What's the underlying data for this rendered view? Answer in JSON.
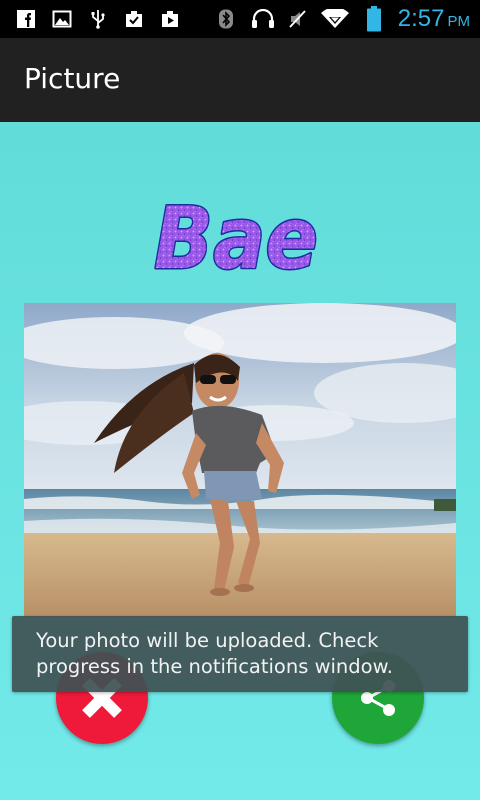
{
  "status_bar": {
    "time": "2:57",
    "ampm": "PM",
    "icons": [
      "facebook-icon",
      "gallery-icon",
      "usb-icon",
      "clipboard-check-icon",
      "media-icon",
      "bluetooth-icon",
      "headset-icon",
      "mute-icon",
      "wifi-icon",
      "battery-icon"
    ],
    "time_color": "#33b5e5"
  },
  "action_bar": {
    "title": "Picture"
  },
  "content": {
    "logo_text": "Bae",
    "photo_subject": "Woman in sunglasses running on a beach",
    "toast": "Your photo will be uploaded. Check progress in the notifications window."
  },
  "actions": {
    "cancel_icon": "close-icon",
    "share_icon": "share-icon"
  },
  "colors": {
    "background": "#6ee0e0",
    "action_bar": "#212121",
    "cancel": "#ef1939",
    "share": "#1fa638",
    "logo_fill": "#9b59e8",
    "logo_outline": "#1a2e9e"
  }
}
